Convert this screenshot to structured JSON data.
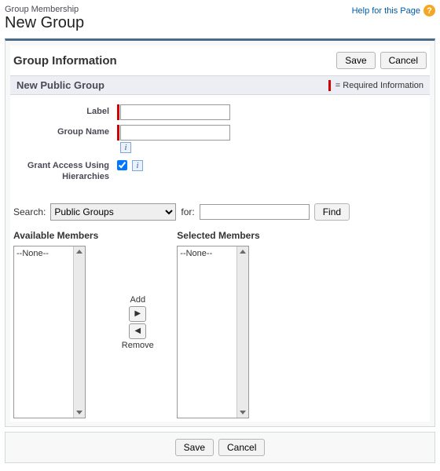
{
  "header": {
    "breadcrumb": "Group Membership",
    "title": "New Group",
    "help_text": "Help for this Page",
    "help_icon": "?"
  },
  "section": {
    "title": "Group Information",
    "save": "Save",
    "cancel": "Cancel",
    "subtitle": "New Public Group",
    "required_text": "= Required Information"
  },
  "form": {
    "label_lbl": "Label",
    "label_val": "",
    "groupname_lbl": "Group Name",
    "groupname_val": "",
    "grant_lbl": "Grant Access Using Hierarchies",
    "grant_checked": true
  },
  "search": {
    "search_lbl": "Search:",
    "dropdown": "Public Groups",
    "for_lbl": "for:",
    "for_val": "",
    "find": "Find"
  },
  "duallist": {
    "available_title": "Available Members",
    "selected_title": "Selected Members",
    "none": "--None--",
    "add": "Add",
    "remove": "Remove"
  },
  "footer": {
    "save": "Save",
    "cancel": "Cancel"
  }
}
